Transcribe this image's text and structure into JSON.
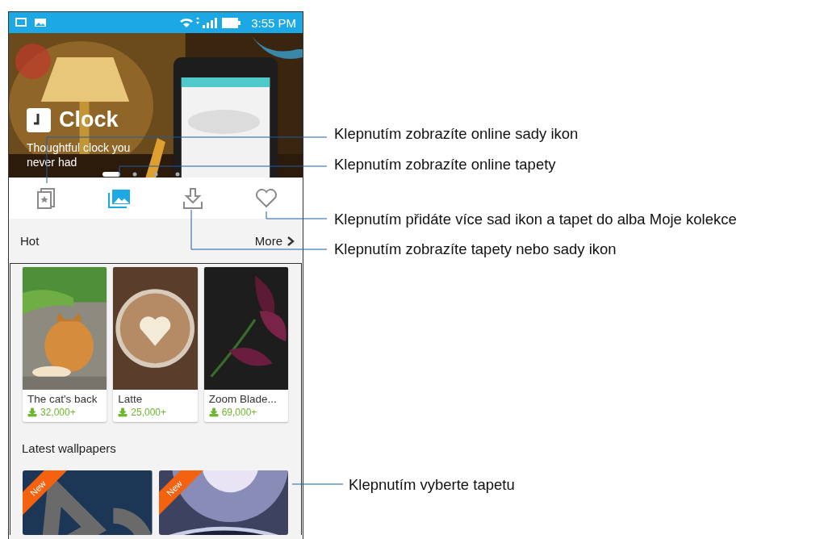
{
  "status_bar": {
    "time": "3:55 PM"
  },
  "banner": {
    "title": "Clock",
    "subtitle": "Thoughtful clock you never had"
  },
  "tabs": [
    {
      "selected": false
    },
    {
      "selected": true
    },
    {
      "selected": false
    },
    {
      "selected": false
    }
  ],
  "hot": {
    "title": "Hot",
    "more": "More",
    "items": [
      {
        "title": "The cat's back",
        "downloads": "32,000+"
      },
      {
        "title": "Latte",
        "downloads": "25,000+"
      },
      {
        "title": "Zoom Blade...",
        "downloads": "69,000+"
      }
    ]
  },
  "latest": {
    "title": "Latest wallpapers",
    "items": [
      {
        "badge": "New"
      },
      {
        "badge": "New"
      }
    ]
  },
  "callouts": [
    {
      "text": "Klepnutím zobrazíte online sady ikon"
    },
    {
      "text": "Klepnutím zobrazíte online tapety"
    },
    {
      "text": "Klepnutím přidáte více sad ikon a tapet do alba Moje kolekce"
    },
    {
      "text": "Klepnutím zobrazíte tapety nebo sady ikon"
    },
    {
      "text": "Klepnutím vyberte tapetu"
    }
  ]
}
